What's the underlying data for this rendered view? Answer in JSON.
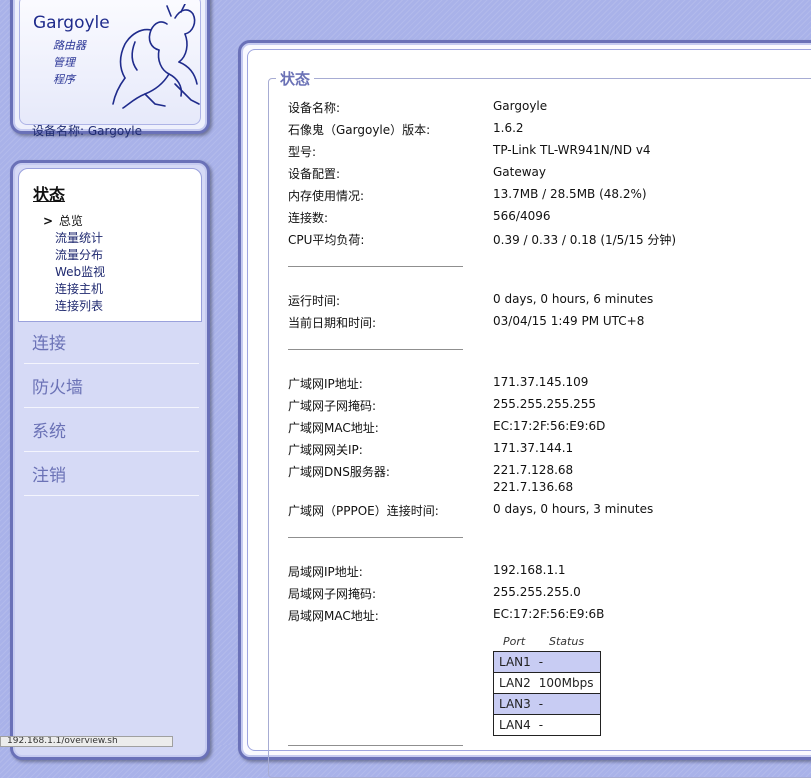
{
  "header": {
    "brand": "Gargoyle",
    "tagline": [
      "路由器",
      "管理",
      "程序"
    ],
    "device_label": "设备名称:",
    "device_name": "Gargoyle"
  },
  "nav": {
    "active_section": "状态",
    "sub_items": [
      "总览",
      "流量统计",
      "流量分布",
      "Web监视",
      "连接主机",
      "连接列表"
    ],
    "current_sub": "总览",
    "sections": [
      "连接",
      "防火墙",
      "系统",
      "注销"
    ]
  },
  "status": {
    "legend": "状态",
    "groups": [
      {
        "rows": [
          {
            "label": "设备名称:",
            "value": "Gargoyle"
          },
          {
            "label": "石像鬼（Gargoyle）版本:",
            "value": "1.6.2"
          },
          {
            "label": "型号:",
            "value": "TP-Link TL-WR941N/ND v4"
          },
          {
            "label": "设备配置:",
            "value": "Gateway"
          },
          {
            "label": "内存使用情况:",
            "value": "13.7MB / 28.5MB (48.2%)"
          },
          {
            "label": "连接数:",
            "value": "566/4096"
          },
          {
            "label": "CPU平均负荷:",
            "value": "0.39 / 0.33 / 0.18  (1/5/15 分钟)"
          }
        ]
      },
      {
        "rows": [
          {
            "label": "运行时间:",
            "value": "0 days, 0 hours, 6 minutes"
          },
          {
            "label": "当前日期和时间:",
            "value": "03/04/15 1:49 PM UTC+8"
          }
        ]
      },
      {
        "rows": [
          {
            "label": "广域网IP地址:",
            "value": "171.37.145.109"
          },
          {
            "label": "广域网子网掩码:",
            "value": "255.255.255.255"
          },
          {
            "label": "广域网MAC地址:",
            "value": "EC:17:2F:56:E9:6D"
          },
          {
            "label": "广域网网关IP:",
            "value": "171.37.144.1"
          },
          {
            "label": "广域网DNS服务器:",
            "value": "221.7.128.68",
            "value2": "221.7.136.68"
          },
          {
            "label": "广域网（PPPOE）连接时间:",
            "value": "0 days, 0 hours, 3 minutes"
          }
        ]
      },
      {
        "rows": [
          {
            "label": "局域网IP地址:",
            "value": "192.168.1.1"
          },
          {
            "label": "局域网子网掩码:",
            "value": "255.255.255.0"
          },
          {
            "label": "局域网MAC地址:",
            "value": "EC:17:2F:56:E9:6B"
          }
        ]
      }
    ],
    "port_table": {
      "headers": [
        "Port",
        "Status"
      ],
      "rows": [
        {
          "port": "LAN1",
          "status": "-"
        },
        {
          "port": "LAN2",
          "status": "100Mbps"
        },
        {
          "port": "LAN3",
          "status": "-"
        },
        {
          "port": "LAN4",
          "status": "-"
        }
      ]
    }
  },
  "statusbar": {
    "text": "192.168.1.1/overview.sh"
  }
}
